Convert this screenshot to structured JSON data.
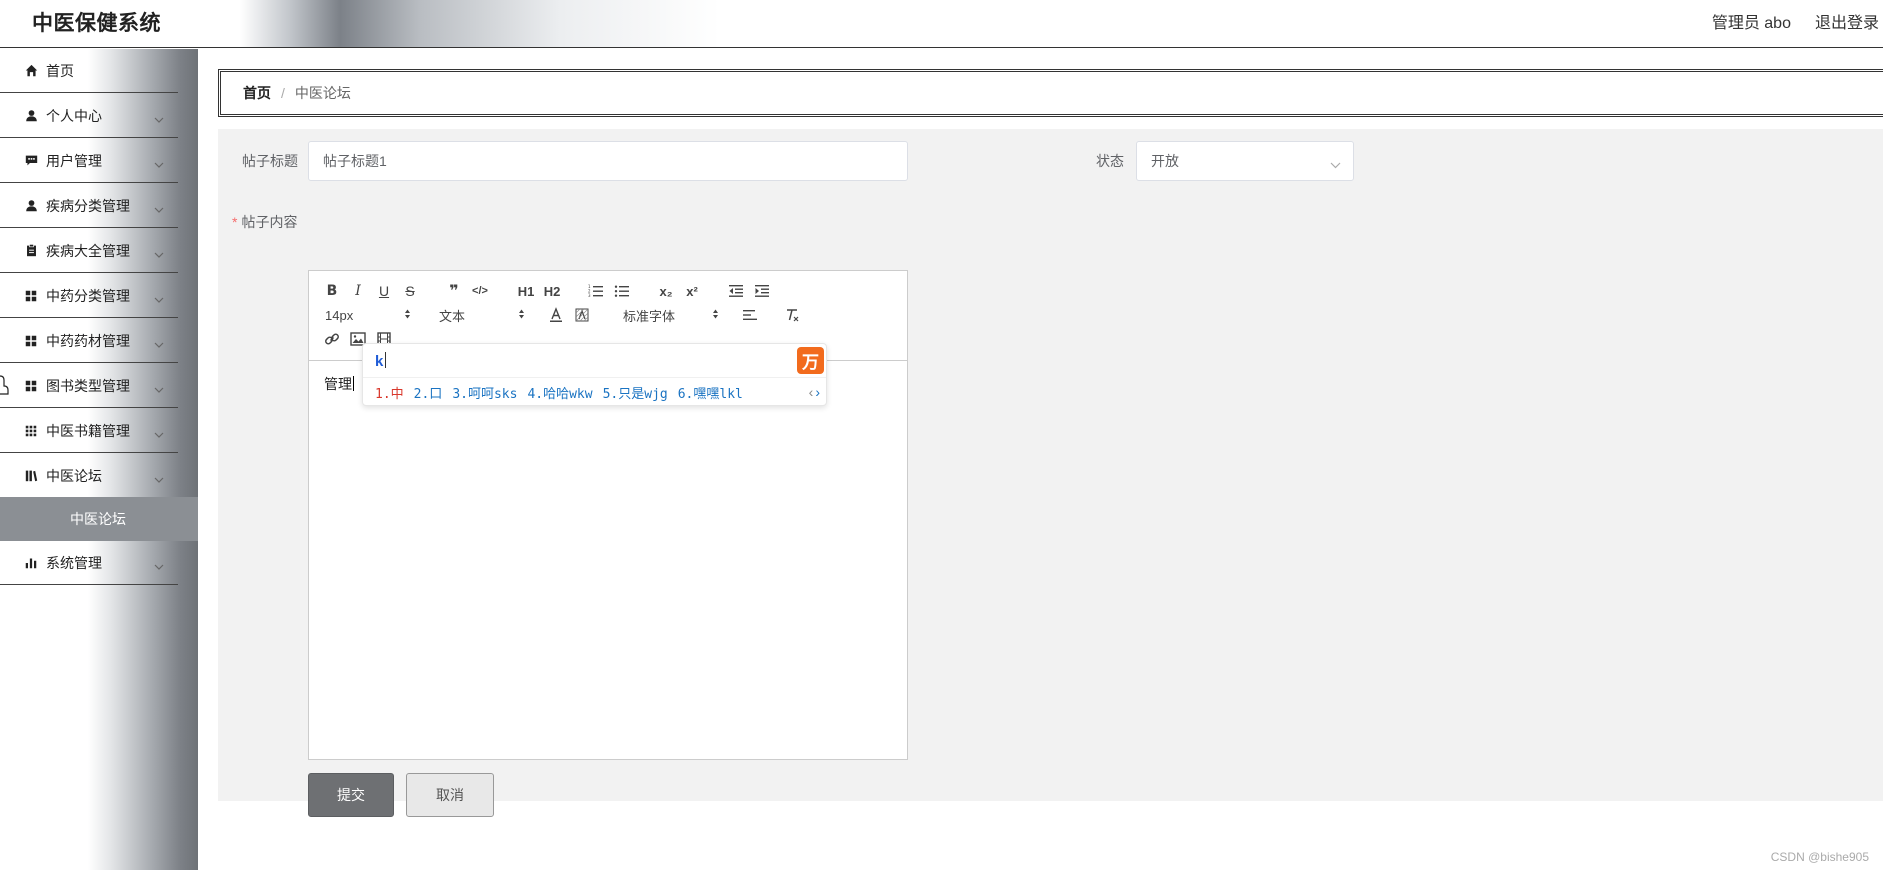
{
  "header": {
    "app_title": "中医保健系统",
    "user_label": "管理员 abo",
    "logout_label": "退出登录"
  },
  "sidebar": {
    "items": [
      {
        "label": "首页",
        "icon": "home-icon"
      },
      {
        "label": "个人中心",
        "icon": "user-icon"
      },
      {
        "label": "用户管理",
        "icon": "chat-icon"
      },
      {
        "label": "疾病分类管理",
        "icon": "user-icon"
      },
      {
        "label": "疾病大全管理",
        "icon": "clipboard-icon"
      },
      {
        "label": "中药分类管理",
        "icon": "grid-icon"
      },
      {
        "label": "中药药材管理",
        "icon": "grid-icon"
      },
      {
        "label": "图书类型管理",
        "icon": "grid-icon"
      },
      {
        "label": "中医书籍管理",
        "icon": "apps-icon"
      },
      {
        "label": "中医论坛",
        "icon": "library-icon"
      },
      {
        "label": "系统管理",
        "icon": "bar-chart-icon"
      }
    ],
    "active_submenu": "中医论坛"
  },
  "breadcrumb": {
    "home": "首页",
    "separator": "/",
    "current": "中医论坛"
  },
  "form": {
    "title_label": "帖子标题",
    "title_value": "帖子标题1",
    "status_label": "状态",
    "status_value": "开放",
    "content_label": "帖子内容",
    "content_required": "*",
    "content_value": "管理"
  },
  "editor": {
    "toolbar": {
      "bold": "B",
      "italic": "I",
      "underline": "U",
      "strike": "S",
      "quote": "❞",
      "code": "</>",
      "h1": "H1",
      "h2": "H2",
      "subscript": "x₂",
      "superscript": "x²",
      "size_value": "14px",
      "header_value": "文本",
      "font_value": "标准字体"
    }
  },
  "ime": {
    "input": "k",
    "logo": "万",
    "candidates": [
      "1.中",
      "2.口",
      "3.呵呵sks",
      "4.哈哈wkw",
      "5.只是wjg",
      "6.嘿嘿lkl"
    ],
    "prev": "‹",
    "next": "›"
  },
  "buttons": {
    "submit": "提交",
    "cancel": "取消"
  },
  "watermark": "CSDN @bishe905"
}
